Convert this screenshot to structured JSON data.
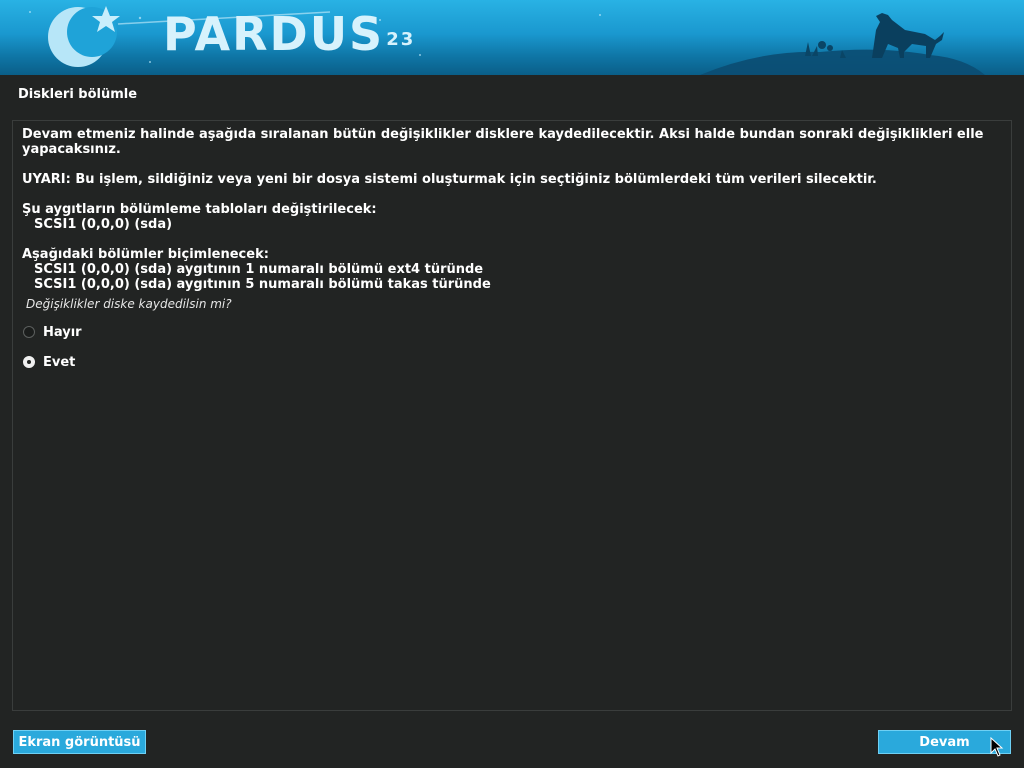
{
  "banner": {
    "logo_text": "PARDUS",
    "version": "23"
  },
  "header": {
    "title": "Diskleri bölümle"
  },
  "content": {
    "intro_line1": "Devam etmeniz halinde aşağıda sıralanan bütün değişiklikler disklere kaydedilecektir. Aksi halde bundan sonraki değişiklikleri elle",
    "intro_line2": "yapacaksınız.",
    "warning": "UYARI: Bu işlem, sildiğiniz veya yeni bir dosya sistemi oluşturmak için seçtiğiniz bölümlerdeki tüm verileri silecektir.",
    "tables_heading": "Şu aygıtların bölümleme tabloları değiştirilecek:",
    "tables_device": "SCSI1 (0,0,0) (sda)",
    "format_heading": "Aşağıdaki bölümler biçimlenecek:",
    "format_items": [
      "SCSI1 (0,0,0) (sda) aygıtının 1 numaralı bölümü ext4 türünde",
      "SCSI1 (0,0,0) (sda) aygıtının 5 numaralı bölümü takas türünde"
    ],
    "question": "Değişiklikler diske kaydedilsin mi?",
    "options": [
      {
        "label": "Hayır",
        "selected": false
      },
      {
        "label": "Evet",
        "selected": true
      }
    ]
  },
  "footer": {
    "screenshot_label": "Ekran görüntüsü",
    "continue_label": "Devam"
  },
  "colors": {
    "background": "#222423",
    "accent": "#2aa9dc",
    "banner_top": "#29b2e4",
    "banner_bottom": "#0a5e88"
  }
}
